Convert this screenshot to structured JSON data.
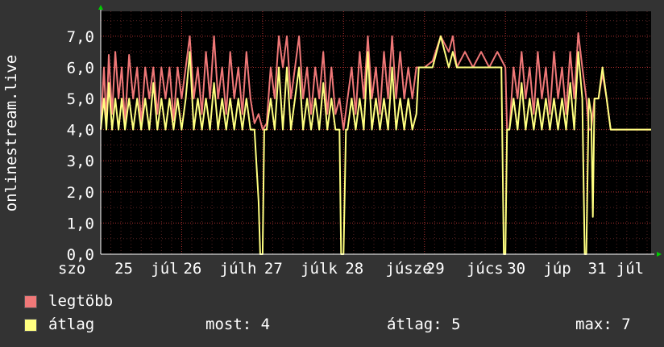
{
  "chart_data": {
    "type": "line",
    "ylabel": "onlinestream.live",
    "ylim": [
      0,
      7.8
    ],
    "yticks": [
      "0,0",
      "1,0",
      "2,0",
      "3,0",
      "4,0",
      "5,0",
      "6,0",
      "7,0"
    ],
    "xlim": [
      0,
      6.8
    ],
    "xticks": [
      {
        "x": 0.0,
        "label": "szo"
      },
      {
        "x": 0.15,
        "label": "25"
      },
      {
        "x": 0.6,
        "label": "júl"
      },
      {
        "x": 1.0,
        "label": "26"
      },
      {
        "x": 1.45,
        "label": "júlh"
      },
      {
        "x": 2.0,
        "label": "27"
      },
      {
        "x": 2.45,
        "label": "júlk"
      },
      {
        "x": 3.0,
        "label": "28"
      },
      {
        "x": 3.5,
        "label": "júsze"
      },
      {
        "x": 4.0,
        "label": "29"
      },
      {
        "x": 4.5,
        "label": "júcs"
      },
      {
        "x": 5.0,
        "label": "30"
      },
      {
        "x": 5.45,
        "label": "júp"
      },
      {
        "x": 6.0,
        "label": "31"
      },
      {
        "x": 6.35,
        "label": "júl"
      }
    ],
    "grid": true,
    "series": [
      {
        "name": "legtöbb",
        "color": "#f07878",
        "points": [
          [
            0,
            4
          ],
          [
            0.04,
            6
          ],
          [
            0.07,
            4.2
          ],
          [
            0.1,
            6.4
          ],
          [
            0.14,
            4.5
          ],
          [
            0.18,
            6.5
          ],
          [
            0.22,
            5
          ],
          [
            0.26,
            6
          ],
          [
            0.3,
            4.2
          ],
          [
            0.35,
            6.4
          ],
          [
            0.4,
            5
          ],
          [
            0.45,
            6
          ],
          [
            0.5,
            4.2
          ],
          [
            0.55,
            6
          ],
          [
            0.6,
            5
          ],
          [
            0.65,
            6
          ],
          [
            0.7,
            4.5
          ],
          [
            0.75,
            6
          ],
          [
            0.8,
            5
          ],
          [
            0.85,
            6
          ],
          [
            0.9,
            4.3
          ],
          [
            0.95,
            6
          ],
          [
            1.0,
            5
          ],
          [
            1.05,
            6
          ],
          [
            1.1,
            7
          ],
          [
            1.15,
            5
          ],
          [
            1.2,
            6
          ],
          [
            1.25,
            4.5
          ],
          [
            1.3,
            6.5
          ],
          [
            1.35,
            5
          ],
          [
            1.4,
            7
          ],
          [
            1.45,
            5
          ],
          [
            1.5,
            6
          ],
          [
            1.55,
            4.5
          ],
          [
            1.6,
            6.5
          ],
          [
            1.65,
            5
          ],
          [
            1.7,
            6
          ],
          [
            1.75,
            4.5
          ],
          [
            1.8,
            6.5
          ],
          [
            1.85,
            5
          ],
          [
            1.9,
            4.2
          ],
          [
            1.95,
            4.5
          ],
          [
            2.0,
            4
          ],
          [
            2.05,
            4.2
          ],
          [
            2.1,
            6
          ],
          [
            2.15,
            5
          ],
          [
            2.2,
            7
          ],
          [
            2.25,
            6
          ],
          [
            2.3,
            7
          ],
          [
            2.35,
            5
          ],
          [
            2.4,
            6
          ],
          [
            2.45,
            7
          ],
          [
            2.5,
            5
          ],
          [
            2.55,
            6
          ],
          [
            2.6,
            4.5
          ],
          [
            2.65,
            6
          ],
          [
            2.7,
            5
          ],
          [
            2.75,
            6.5
          ],
          [
            2.8,
            4.5
          ],
          [
            2.85,
            6
          ],
          [
            2.9,
            4.5
          ],
          [
            2.95,
            5
          ],
          [
            3.0,
            4
          ],
          [
            3.05,
            5
          ],
          [
            3.1,
            6
          ],
          [
            3.15,
            4.5
          ],
          [
            3.2,
            6.5
          ],
          [
            3.25,
            5
          ],
          [
            3.3,
            7
          ],
          [
            3.35,
            5
          ],
          [
            3.4,
            6
          ],
          [
            3.45,
            4.5
          ],
          [
            3.5,
            6.5
          ],
          [
            3.55,
            5
          ],
          [
            3.6,
            7
          ],
          [
            3.65,
            5
          ],
          [
            3.7,
            6.5
          ],
          [
            3.75,
            5
          ],
          [
            3.8,
            6
          ],
          [
            3.85,
            5
          ],
          [
            3.9,
            6
          ],
          [
            3.93,
            6
          ],
          [
            4.0,
            6
          ],
          [
            4.1,
            6.2
          ],
          [
            4.2,
            7
          ],
          [
            4.3,
            6.5
          ],
          [
            4.35,
            7
          ],
          [
            4.4,
            6
          ],
          [
            4.5,
            6.5
          ],
          [
            4.6,
            6
          ],
          [
            4.7,
            6.5
          ],
          [
            4.8,
            6
          ],
          [
            4.9,
            6.5
          ],
          [
            5.0,
            6
          ],
          [
            5.02,
            4
          ],
          [
            5.05,
            4
          ],
          [
            5.1,
            6
          ],
          [
            5.15,
            5
          ],
          [
            5.2,
            6.5
          ],
          [
            5.25,
            5
          ],
          [
            5.3,
            6
          ],
          [
            5.35,
            4.5
          ],
          [
            5.4,
            6.5
          ],
          [
            5.45,
            5
          ],
          [
            5.5,
            6
          ],
          [
            5.55,
            4.5
          ],
          [
            5.6,
            6.5
          ],
          [
            5.65,
            5
          ],
          [
            5.7,
            6
          ],
          [
            5.75,
            4.5
          ],
          [
            5.8,
            6.5
          ],
          [
            5.85,
            5
          ],
          [
            5.9,
            7.1
          ],
          [
            5.95,
            6
          ],
          [
            6.0,
            5
          ],
          [
            6.03,
            4
          ],
          [
            6.06,
            4
          ],
          [
            6.1,
            5
          ],
          [
            6.15,
            5
          ],
          [
            6.2,
            5.8
          ],
          [
            6.25,
            5
          ],
          [
            6.3,
            4
          ],
          [
            6.8,
            4
          ]
        ]
      },
      {
        "name": "átlag",
        "color": "#ffff80",
        "points": [
          [
            0,
            4
          ],
          [
            0.04,
            5
          ],
          [
            0.07,
            4
          ],
          [
            0.1,
            5.5
          ],
          [
            0.14,
            4
          ],
          [
            0.18,
            5
          ],
          [
            0.22,
            4
          ],
          [
            0.26,
            5
          ],
          [
            0.3,
            4
          ],
          [
            0.35,
            5
          ],
          [
            0.4,
            4
          ],
          [
            0.45,
            5
          ],
          [
            0.5,
            4
          ],
          [
            0.55,
            5
          ],
          [
            0.6,
            4
          ],
          [
            0.65,
            5.5
          ],
          [
            0.7,
            4
          ],
          [
            0.75,
            5
          ],
          [
            0.8,
            4
          ],
          [
            0.85,
            5
          ],
          [
            0.9,
            4
          ],
          [
            0.95,
            5
          ],
          [
            1.0,
            4
          ],
          [
            1.05,
            5
          ],
          [
            1.1,
            6.5
          ],
          [
            1.15,
            4
          ],
          [
            1.2,
            5
          ],
          [
            1.25,
            4
          ],
          [
            1.3,
            5
          ],
          [
            1.35,
            4
          ],
          [
            1.4,
            5.5
          ],
          [
            1.45,
            4
          ],
          [
            1.5,
            5
          ],
          [
            1.55,
            4
          ],
          [
            1.6,
            5
          ],
          [
            1.65,
            4
          ],
          [
            1.7,
            5
          ],
          [
            1.75,
            4
          ],
          [
            1.8,
            5
          ],
          [
            1.85,
            4
          ],
          [
            1.9,
            4
          ],
          [
            1.95,
            1.7
          ],
          [
            1.97,
            0
          ],
          [
            2.0,
            0
          ],
          [
            2.02,
            4
          ],
          [
            2.05,
            4
          ],
          [
            2.1,
            5
          ],
          [
            2.15,
            4
          ],
          [
            2.2,
            6
          ],
          [
            2.25,
            4
          ],
          [
            2.3,
            6
          ],
          [
            2.35,
            4
          ],
          [
            2.4,
            5
          ],
          [
            2.45,
            6
          ],
          [
            2.5,
            4
          ],
          [
            2.55,
            5
          ],
          [
            2.6,
            4
          ],
          [
            2.65,
            5
          ],
          [
            2.7,
            4
          ],
          [
            2.75,
            5.5
          ],
          [
            2.8,
            4
          ],
          [
            2.85,
            5
          ],
          [
            2.9,
            4
          ],
          [
            2.95,
            4
          ],
          [
            2.97,
            0
          ],
          [
            3.0,
            0
          ],
          [
            3.03,
            4
          ],
          [
            3.05,
            4
          ],
          [
            3.1,
            5
          ],
          [
            3.15,
            4
          ],
          [
            3.2,
            5
          ],
          [
            3.25,
            4
          ],
          [
            3.3,
            6.5
          ],
          [
            3.35,
            4
          ],
          [
            3.4,
            5
          ],
          [
            3.45,
            4
          ],
          [
            3.5,
            5
          ],
          [
            3.55,
            4
          ],
          [
            3.6,
            6
          ],
          [
            3.65,
            4
          ],
          [
            3.7,
            5
          ],
          [
            3.75,
            4
          ],
          [
            3.8,
            5
          ],
          [
            3.85,
            4
          ],
          [
            3.9,
            4.5
          ],
          [
            3.93,
            6
          ],
          [
            4.0,
            6
          ],
          [
            4.1,
            6
          ],
          [
            4.2,
            7
          ],
          [
            4.3,
            6
          ],
          [
            4.35,
            6.5
          ],
          [
            4.4,
            6
          ],
          [
            4.5,
            6
          ],
          [
            4.6,
            6
          ],
          [
            4.7,
            6
          ],
          [
            4.8,
            6
          ],
          [
            4.9,
            6
          ],
          [
            4.95,
            6
          ],
          [
            4.98,
            0
          ],
          [
            5.0,
            0
          ],
          [
            5.02,
            4
          ],
          [
            5.05,
            4
          ],
          [
            5.1,
            5
          ],
          [
            5.15,
            4
          ],
          [
            5.2,
            5.5
          ],
          [
            5.25,
            4
          ],
          [
            5.3,
            5
          ],
          [
            5.35,
            4
          ],
          [
            5.4,
            5
          ],
          [
            5.45,
            4
          ],
          [
            5.5,
            5
          ],
          [
            5.55,
            4
          ],
          [
            5.6,
            5
          ],
          [
            5.65,
            4
          ],
          [
            5.7,
            5
          ],
          [
            5.75,
            4
          ],
          [
            5.8,
            5.5
          ],
          [
            5.85,
            4
          ],
          [
            5.9,
            6.5
          ],
          [
            5.95,
            5
          ],
          [
            5.98,
            0
          ],
          [
            6.0,
            0
          ],
          [
            6.03,
            5
          ],
          [
            6.06,
            4.5
          ],
          [
            6.08,
            1.2
          ],
          [
            6.1,
            5
          ],
          [
            6.15,
            5
          ],
          [
            6.2,
            6
          ],
          [
            6.25,
            5
          ],
          [
            6.3,
            4
          ],
          [
            6.8,
            4
          ]
        ]
      }
    ]
  },
  "legend": {
    "max_label": "legtöbb",
    "avg_label": "átlag",
    "max_color": "#f07878",
    "avg_color": "#ffff80"
  },
  "stats": {
    "now": "most: 4",
    "avg": "átlag: 5",
    "max": "max: 7"
  }
}
